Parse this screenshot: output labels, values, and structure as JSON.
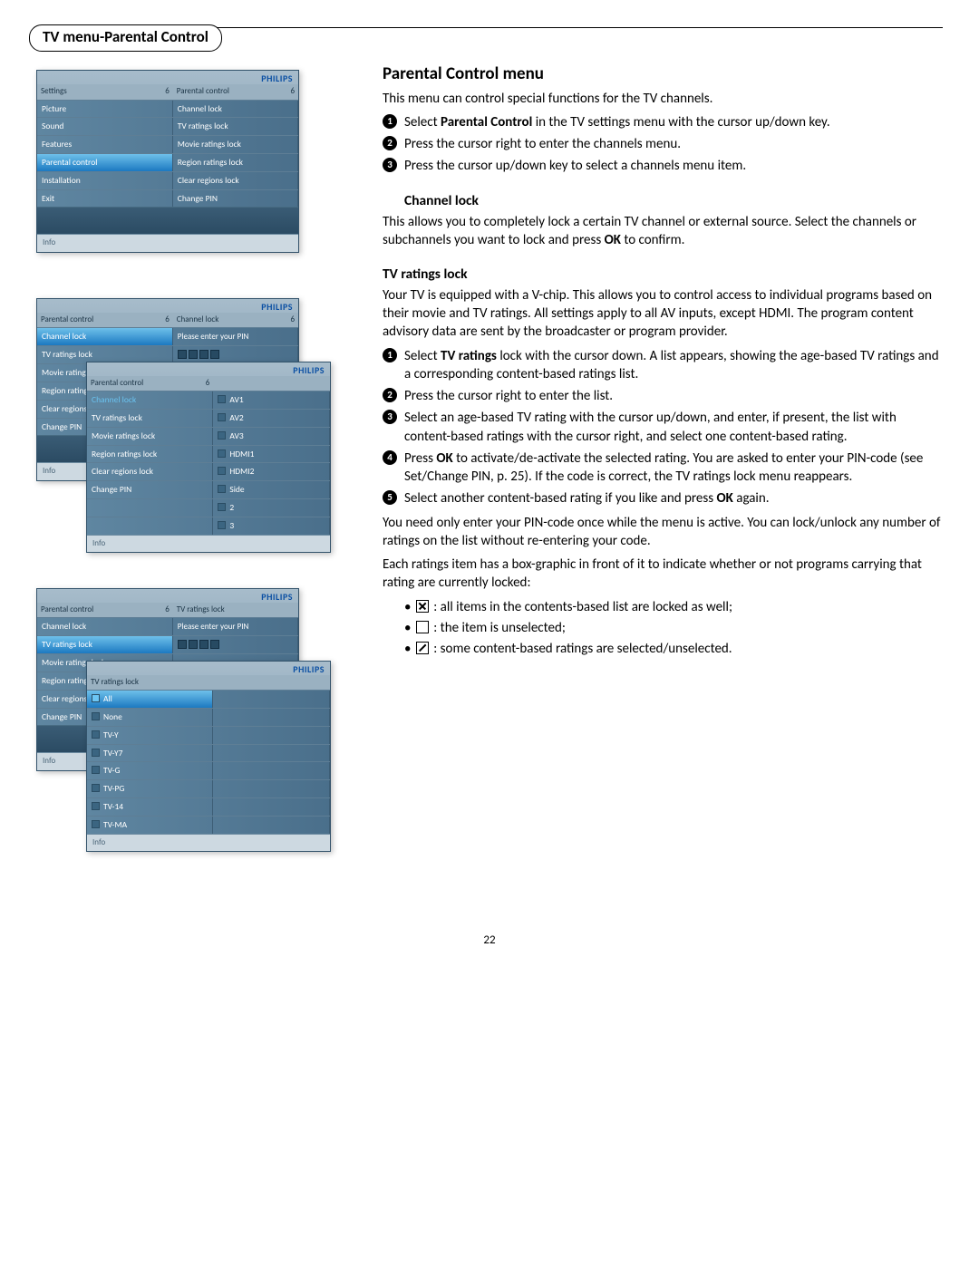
{
  "section_badge": "TV menu-Parental Control",
  "page_number": "22",
  "brand": "PHILIPS",
  "info_label": "Info",
  "right": {
    "title": "Parental Control menu",
    "intro": "This menu can control special functions for the TV channels.",
    "steps_top": [
      {
        "n": "1",
        "pre": "Select ",
        "bold": "Parental Control",
        "post": " in the TV settings menu with the cursor up/down key."
      },
      {
        "n": "2",
        "text": "Press the cursor right to enter the channels menu."
      },
      {
        "n": "3",
        "text": "Press the cursor up/down key to select a channels menu item."
      }
    ],
    "channel_lock_h": "Channel lock",
    "channel_lock_body_a": "This allows you to completely lock a certain TV channel or external source. Select the channels or subchannels you want to lock and press ",
    "channel_lock_bold": "OK",
    "channel_lock_body_b": " to confirm.",
    "tvr_h": "TV ratings lock",
    "tvr_body": "Your TV is equipped with a V-chip. This allows you to control access to individual programs based on their movie and TV ratings. All settings apply to all AV inputs, except HDMI. The program content advisory data are sent by the broadcaster or program provider.",
    "tvr_steps": [
      {
        "n": "1",
        "pre": "Select ",
        "bold": "TV ratings",
        "post": " lock with the cursor down. A list appears, showing the age-based TV ratings and a corresponding content-based ratings list."
      },
      {
        "n": "2",
        "text": "Press the cursor right to enter the list."
      },
      {
        "n": "3",
        "text": "Select an age-based TV rating with the cursor up/down, and enter, if present, the list with content-based ratings with the cursor right, and select one content-based rating."
      },
      {
        "n": "4",
        "pre": "Press ",
        "bold": "OK",
        "post": " to activate/de-activate the selected rating. You are asked to enter your PIN-code (see Set/Change PIN, p. 25). If the code is correct, the TV ratings lock menu reappears."
      },
      {
        "n": "5",
        "pre": "Select another content-based rating if you like and press ",
        "bold": "OK",
        "post": " again."
      }
    ],
    "pin_once": "You need only enter your PIN-code once while the menu is active. You can lock/unlock any number of ratings on the list without re-entering your code.",
    "box_intro": "Each ratings item has a box-graphic in front of it to indicate whether or not programs carrying that rating are currently locked:",
    "bul_x": ": all items in the contents-based list are locked as well;",
    "bul_empty": ": the item is unselected;",
    "bul_slash": ": some content-based ratings are selected/unselected."
  },
  "tv1": {
    "hdr_l": "Settings",
    "hdr_l_n": "6",
    "hdr_r": "Parental control",
    "hdr_r_n": "6",
    "rows": [
      {
        "l": "Picture",
        "r": "Channel lock"
      },
      {
        "l": "Sound",
        "r": "TV ratings lock"
      },
      {
        "l": "Features",
        "r": "Movie ratings lock"
      },
      {
        "l": "Parental control",
        "r": "Region ratings lock",
        "sel": true
      },
      {
        "l": "Installation",
        "r": "Clear regions lock"
      },
      {
        "l": "Exit",
        "r": "Change PIN"
      }
    ]
  },
  "tv2a": {
    "hdr_l": "Parental control",
    "hdr_l_n": "6",
    "hdr_r": "Channel lock",
    "hdr_r_n": "6",
    "pin": "Please enter your PIN",
    "rows": [
      {
        "l": "Channel lock",
        "sel": true
      },
      {
        "l": "TV ratings lock"
      },
      {
        "l": "Movie ratings lock"
      },
      {
        "l": "Region ratings lock"
      },
      {
        "l": "Clear regions lock"
      },
      {
        "l": "Change PIN"
      }
    ]
  },
  "tv2b": {
    "hdr_l": "Parental control",
    "hdr_l_n": "6",
    "rows_l": [
      "Channel lock",
      "TV ratings lock",
      "Movie ratings lock",
      "Region ratings lock",
      "Clear regions lock",
      "Change PIN"
    ],
    "rows_r": [
      "AV1",
      "AV2",
      "AV3",
      "HDMI1",
      "HDMI2",
      "Side",
      "2",
      "3"
    ]
  },
  "tv3a": {
    "hdr_l": "Parental control",
    "hdr_l_n": "6",
    "hdr_r": "TV ratings lock",
    "hdr_r_n": "",
    "pin": "Please enter your PIN",
    "rows": [
      {
        "l": "Channel lock"
      },
      {
        "l": "TV ratings lock",
        "sel": true
      },
      {
        "l": "Movie ratings lock"
      },
      {
        "l": "Region ratings lock"
      },
      {
        "l": "Clear regions lock"
      },
      {
        "l": "Change PIN"
      }
    ]
  },
  "tv3b": {
    "hdr_l": "TV ratings lock",
    "rows": [
      "All",
      "None",
      "TV-Y",
      "TV-Y7",
      "TV-G",
      "TV-PG",
      "TV-14",
      "TV-MA"
    ]
  }
}
